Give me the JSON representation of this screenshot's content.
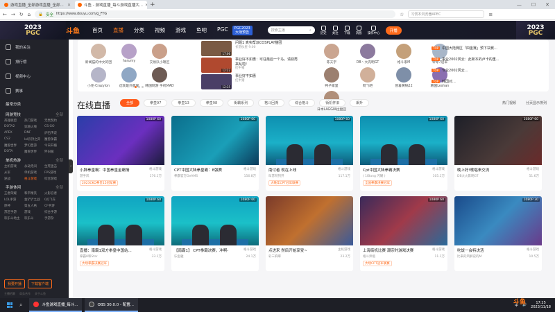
{
  "browser": {
    "tabs": [
      {
        "title": "游戏直播_全部游戏直播_全部...",
        "active": false
      },
      {
        "title": "斗鱼 - 游戏直播_每斗游戏直播大...",
        "active": true
      }
    ],
    "url_secure_label": "安全",
    "url_text": "https://www.douyu.com/g_FTG",
    "right_hint": "习惯本浏览器APEC",
    "win_min": "—",
    "win_max": "☐",
    "win_close": "✕"
  },
  "header": {
    "pgc_year": "2023",
    "pgc_label": "PGC",
    "logo": "斗鱼",
    "nav": [
      "首页",
      "直播",
      "分类",
      "视频",
      "游戏",
      "鱼吧",
      "PGC"
    ],
    "event_line1": "PGC2023",
    "event_line2": "大场预告",
    "search_placeholder": "搜索主播",
    "icons": [
      "历史",
      "关注",
      "下载",
      "消息",
      "操作中心"
    ],
    "kaibo": "开播"
  },
  "sidebar": {
    "menu": [
      "我的关注",
      "排行榜",
      "视频中心",
      "赛事"
    ],
    "sections": [
      {
        "title": "最常分类",
        "more": "",
        "items": []
      },
      {
        "title": "网游竞技",
        "more": "全部",
        "items": [
          "英雄联盟",
          "热门游戏",
          "无畏契约",
          "DOTA2",
          "穿越火线",
          "CS:GO",
          "APEX",
          "DNF",
          "炉石传说",
          "CS2",
          "lol云顶之弈",
          "魔兽争霸",
          "魔兽世界",
          "梦幻西游",
          "今日开播",
          "DOTA",
          "魔兽世界",
          "怀旧服"
        ]
      },
      {
        "title": "单机热游",
        "more": "全部",
        "items": [
          "主机游戏",
          "永劫无间",
          "生死狙击",
          "从军",
          "单机游戏",
          "FPS游戏",
          "逆战",
          "格斗游戏",
          "综合游戏"
        ]
      },
      {
        "title": "手游休闲",
        "more": "全部",
        "items": [
          "王者荣耀",
          "和平精英",
          "火影忍者",
          "LOL手游",
          "金铲铲之战",
          "QQ飞车",
          "原神",
          "第五人格",
          "CF手游",
          "苏区手游",
          "游戏",
          "综合手游",
          "欢乐斗地主",
          "欢乐斗",
          "手游杂"
        ]
      }
    ],
    "btn_open": "我要开播",
    "btn_download": "下载客户端",
    "footer": [
      "主播招募",
      "商务合作",
      "关于斗鱼"
    ]
  },
  "recommend": {
    "users_left": [
      "新闻猫的中文的团",
      "harumy",
      "交易队小嗯区",
      "小花·Crazylon",
      "这就是外面尾",
      "韩国网游 手机MAD"
    ],
    "videos": [
      {
        "title": "问题1 真实帮派COSPLAY猫团",
        "author": "长羽伙星 9:00",
        "dur": "17:06"
      },
      {
        "title": "事业好不如惠：可往最后一个马，请别再来乱啦!",
        "author": "红牛猪",
        "dur": "12:22"
      },
      {
        "title": "事业好不如惠",
        "author": "红牛猪",
        "dur": "12:35"
      }
    ],
    "users_right": [
      "陈天宇",
      "DB丶大壳明GT",
      "格斗家M",
      "零零7冠军",
      "鸭子家里",
      "阿飞吧",
      "冒着黄锅22",
      "韩国Leshan",
      "日本LAGGIA拉盘亚"
    ],
    "ranking": [
      {
        "badge": "TOP",
        "text": "中国大陆赛区「四金赛」预下块赛..."
      },
      {
        "badge": "TOP",
        "text": "事业2002风云：此新本的卢卡的重..."
      },
      {
        "badge": "TOP",
        "text": "专业2002风云..."
      },
      {
        "badge": "TOP",
        "text": "韩国对..."
      }
    ]
  },
  "live": {
    "heading": "在线直播",
    "chips": [
      "全部",
      "拳皇97",
      "拳皇13",
      "拳皇98",
      "街霸系列",
      "格斗回溯",
      "综合格斗",
      "街机怀旧",
      "飙升"
    ],
    "tools": [
      "热门视频",
      "分页显示排列"
    ],
    "cards": [
      {
        "title": "小胖拳皇霸：中国拳皇金霸情",
        "cat": "格斗游戏",
        "anchor": "游手风",
        "hot": "176.1万",
        "tag": "2023CKO拳皇15冠军赛",
        "q": "1080P 60"
      },
      {
        "title": "CPT中国大陆拳皇霸：8强赛",
        "cat": "格斗游戏",
        "anchor": "拳霸官方GeAMS",
        "hot": "156.8万",
        "tag": "",
        "q": "1080P 60"
      },
      {
        "title": "南讨者 现在上线",
        "cat": "格斗游戏",
        "anchor": "叫苏阿列开",
        "hot": "117.1万",
        "tag": "大晚年CPT冠军联赛",
        "q": "1080P 60"
      },
      {
        "title": "Cpt中国大陆拳霸决赛",
        "cat": "格斗游戏",
        "anchor": "( 1lBang 闪耀 )",
        "hot": "105.1万",
        "tag": "全国拳霸决赛冠军",
        "q": "1080P 60"
      },
      {
        "title": "晚上好!歌唱来交流",
        "cat": "格斗游戏",
        "anchor": "DB大火影明GT",
        "hot": "51.6万",
        "tag": "",
        "q": "1080P 60"
      },
      {
        "title": "直播：南霸1双方拳皇中国站...",
        "cat": "格斗游戏",
        "anchor": "拳霸8和Star",
        "hot": "33.1万",
        "tag": "大场拳霸决赛冠军",
        "q": "1080P 60"
      },
      {
        "title": "【南霸1】 CPT拳霸决赛，冲啊-",
        "cat": "格斗游戏",
        "anchor": "乐鱼雅",
        "hot": "24.1万",
        "tag": "",
        "q": "1080P 60"
      },
      {
        "title": "点进来 然后开始享受~",
        "cat": "主机游戏",
        "anchor": "彩三麻麻",
        "hot": "23.2万",
        "tag": "",
        "q": ""
      },
      {
        "title": "上海街机比赛 潮宗时游戏决赛",
        "cat": "格斗游戏",
        "anchor": "格斗师瓶",
        "hot": "11.1万",
        "tag": "大场CPT冠军联赛",
        "q": "1080P 60"
      },
      {
        "title": "吃饭一会特决活",
        "cat": "格斗游戏",
        "anchor": "比来的风解说的M",
        "hot": "10.5万",
        "tag": "",
        "q": "1080P 30"
      }
    ]
  },
  "taskbar": {
    "apps": [
      "斗鱼游戏直播_每斗...",
      "OBS 30.0.0 - 配置..."
    ],
    "tray_lang": "中",
    "time": "17:25",
    "date": "2023/11/18"
  },
  "colors": {
    "accent": "#ff6a1a",
    "sidebar_bg": "#22232a",
    "header_bg": "#171826"
  }
}
